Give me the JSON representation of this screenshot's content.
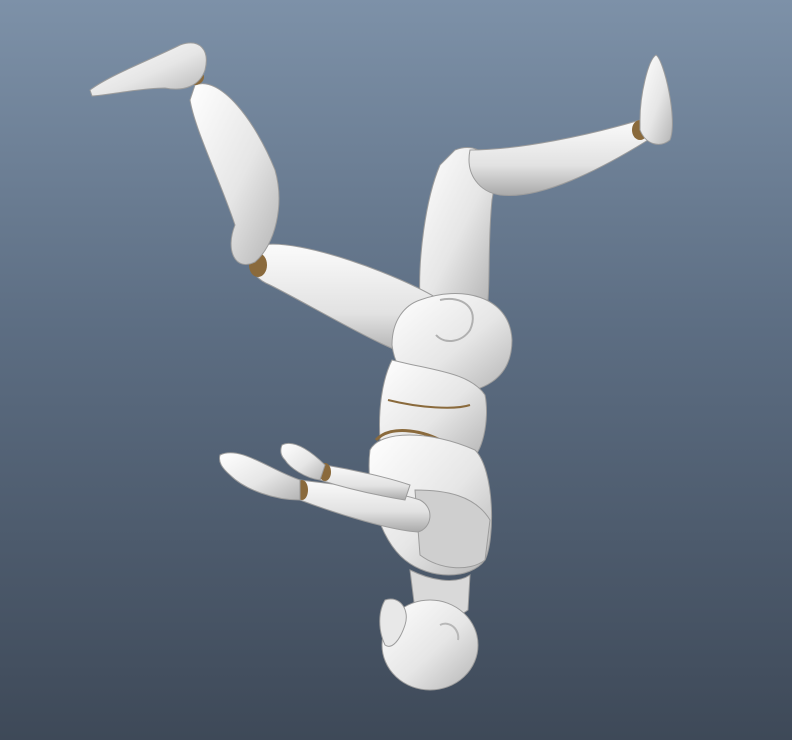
{
  "viewport": {
    "background_top": "#7d91a8",
    "background_bottom": "#3e4958"
  },
  "figure": {
    "subject": "upside-down-mannequin",
    "body_color": "#eaeaea",
    "shade_color": "#b9b9b9",
    "joint_color": "#8a6a3c"
  }
}
